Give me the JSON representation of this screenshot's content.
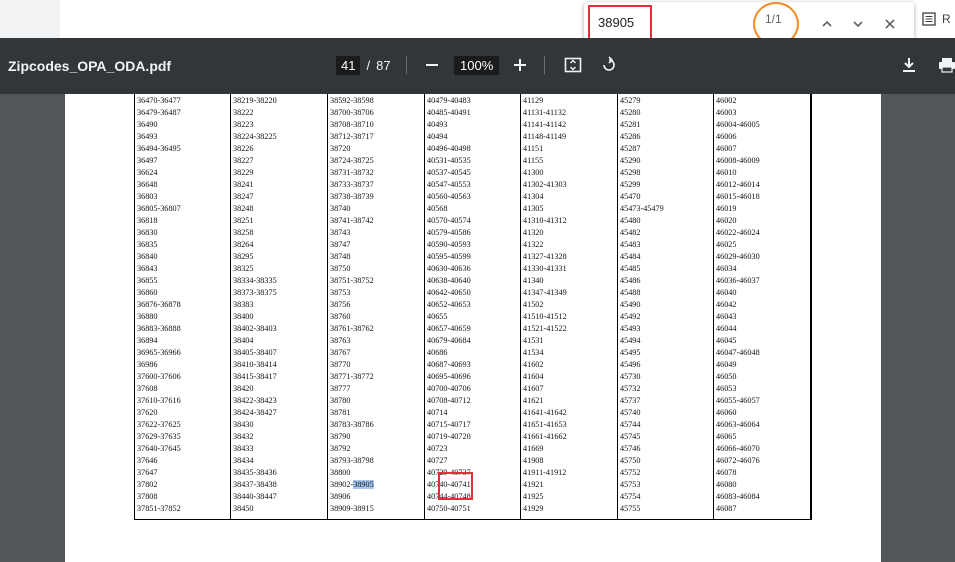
{
  "reading_mode": {
    "label": "R"
  },
  "find_bar": {
    "query": "38905",
    "count": "1/1"
  },
  "toolbar": {
    "title": "Zipcodes_OPA_ODA.pdf",
    "page_current": "41",
    "page_sep": "/",
    "page_total": "87",
    "zoom": "100%"
  },
  "highlight_color": "#a7c8ef",
  "annotation_color": "#e0303a",
  "table": {
    "columns": [
      [
        "36470-36477",
        "36479-36487",
        "36490",
        "36493",
        "36494-36495",
        "36497",
        "36624",
        "36648",
        "36803",
        "36805-36807",
        "36818",
        "36830",
        "36835",
        "36840",
        "36843",
        "36855",
        "36860",
        "36876-36878",
        "36880",
        "36883-36888",
        "36894",
        "36965-36966",
        "36986",
        "37600-37606",
        "37608",
        "37610-37616",
        "37620",
        "37622-37625",
        "37629-37635",
        "37640-37645",
        "37646",
        "37647",
        "37802",
        "37808",
        "37851-37852"
      ],
      [
        "38219-38220",
        "38222",
        "38223",
        "38224-38225",
        "38226",
        "38227",
        "38229",
        "38241",
        "38247",
        "38248",
        "38251",
        "38258",
        "38264",
        "38295",
        "38325",
        "38334-38335",
        "38373-38375",
        "38383",
        "38400",
        "38402-38403",
        "38404",
        "38405-38407",
        "38410-38414",
        "38415-38417",
        "38420",
        "38422-38423",
        "38424-38427",
        "38430",
        "38432",
        "38433",
        "38434",
        "38435-38436",
        "38437-38438",
        "38440-38447",
        "38450"
      ],
      [
        "38592-38598",
        "38700-38706",
        "38708-38710",
        "38712-38717",
        "38720",
        "38724-38725",
        "38731-38732",
        "38733-38737",
        "38738-38739",
        "38740",
        "38741-38742",
        "38743",
        "38747",
        "38748",
        "38750",
        "38751-38752",
        "38753",
        "38756",
        "38760",
        "38761-38762",
        "38763",
        "38767",
        "38770",
        "38771-38772",
        "38777",
        "38780",
        "38781",
        "38783-38786",
        "38790",
        "38792",
        "38793-38798",
        "38800",
        "38902-38905",
        "38906",
        "38909-38915"
      ],
      [
        "40479-40483",
        "40485-40491",
        "40493",
        "40494",
        "40496-40498",
        "40531-40535",
        "40537-40545",
        "40547-40553",
        "40560-40563",
        "40568",
        "40570-40574",
        "40579-40586",
        "40590-40593",
        "40595-40599",
        "40630-40636",
        "40638-40640",
        "40642-40650",
        "40652-40653",
        "40655",
        "40657-40659",
        "40679-40684",
        "40686",
        "40687-40693",
        "40695-40696",
        "40700-40706",
        "40708-40712",
        "40714",
        "40715-40717",
        "40719-40720",
        "40723",
        "40727",
        "40729-40737",
        "40740-40741",
        "40744-40748",
        "40750-40751"
      ],
      [
        "41129",
        "41131-41132",
        "41141-41142",
        "41148-41149",
        "41151",
        "41155",
        "41300",
        "41302-41303",
        "41304",
        "41305",
        "41310-41312",
        "41320",
        "41322",
        "41327-41328",
        "41330-41331",
        "41340",
        "41347-41349",
        "41502",
        "41510-41512",
        "41521-41522",
        "41531",
        "41534",
        "41602",
        "41604",
        "41607",
        "41621",
        "41641-41642",
        "41651-41653",
        "41661-41662",
        "41669",
        "41908",
        "41911-41912",
        "41921",
        "41925",
        "41929"
      ],
      [
        "45279",
        "45280",
        "45281",
        "45286",
        "45287",
        "45290",
        "45298",
        "45299",
        "45470",
        "45473-45479",
        "45480",
        "45482",
        "45483",
        "45484",
        "45485",
        "45486",
        "45488",
        "45490",
        "45492",
        "45493",
        "45494",
        "45495",
        "45496",
        "45730",
        "45732",
        "45737",
        "45740",
        "45744",
        "45745",
        "45746",
        "45750",
        "45752",
        "45753",
        "45754",
        "45755"
      ],
      [
        "46002",
        "46003",
        "46004-46005",
        "46006",
        "46007",
        "46008-46009",
        "46010",
        "46012-46014",
        "46015-46018",
        "46019",
        "46020",
        "46022-46024",
        "46025",
        "46029-46030",
        "46034",
        "46036-46037",
        "46040",
        "46042",
        "46043",
        "46044",
        "46045",
        "46047-46048",
        "46049",
        "46050",
        "46053",
        "46055-46057",
        "46060",
        "46063-46064",
        "46065",
        "46066-46070",
        "46072-46076",
        "46078",
        "46080",
        "46083-46084",
        "46087"
      ]
    ]
  }
}
